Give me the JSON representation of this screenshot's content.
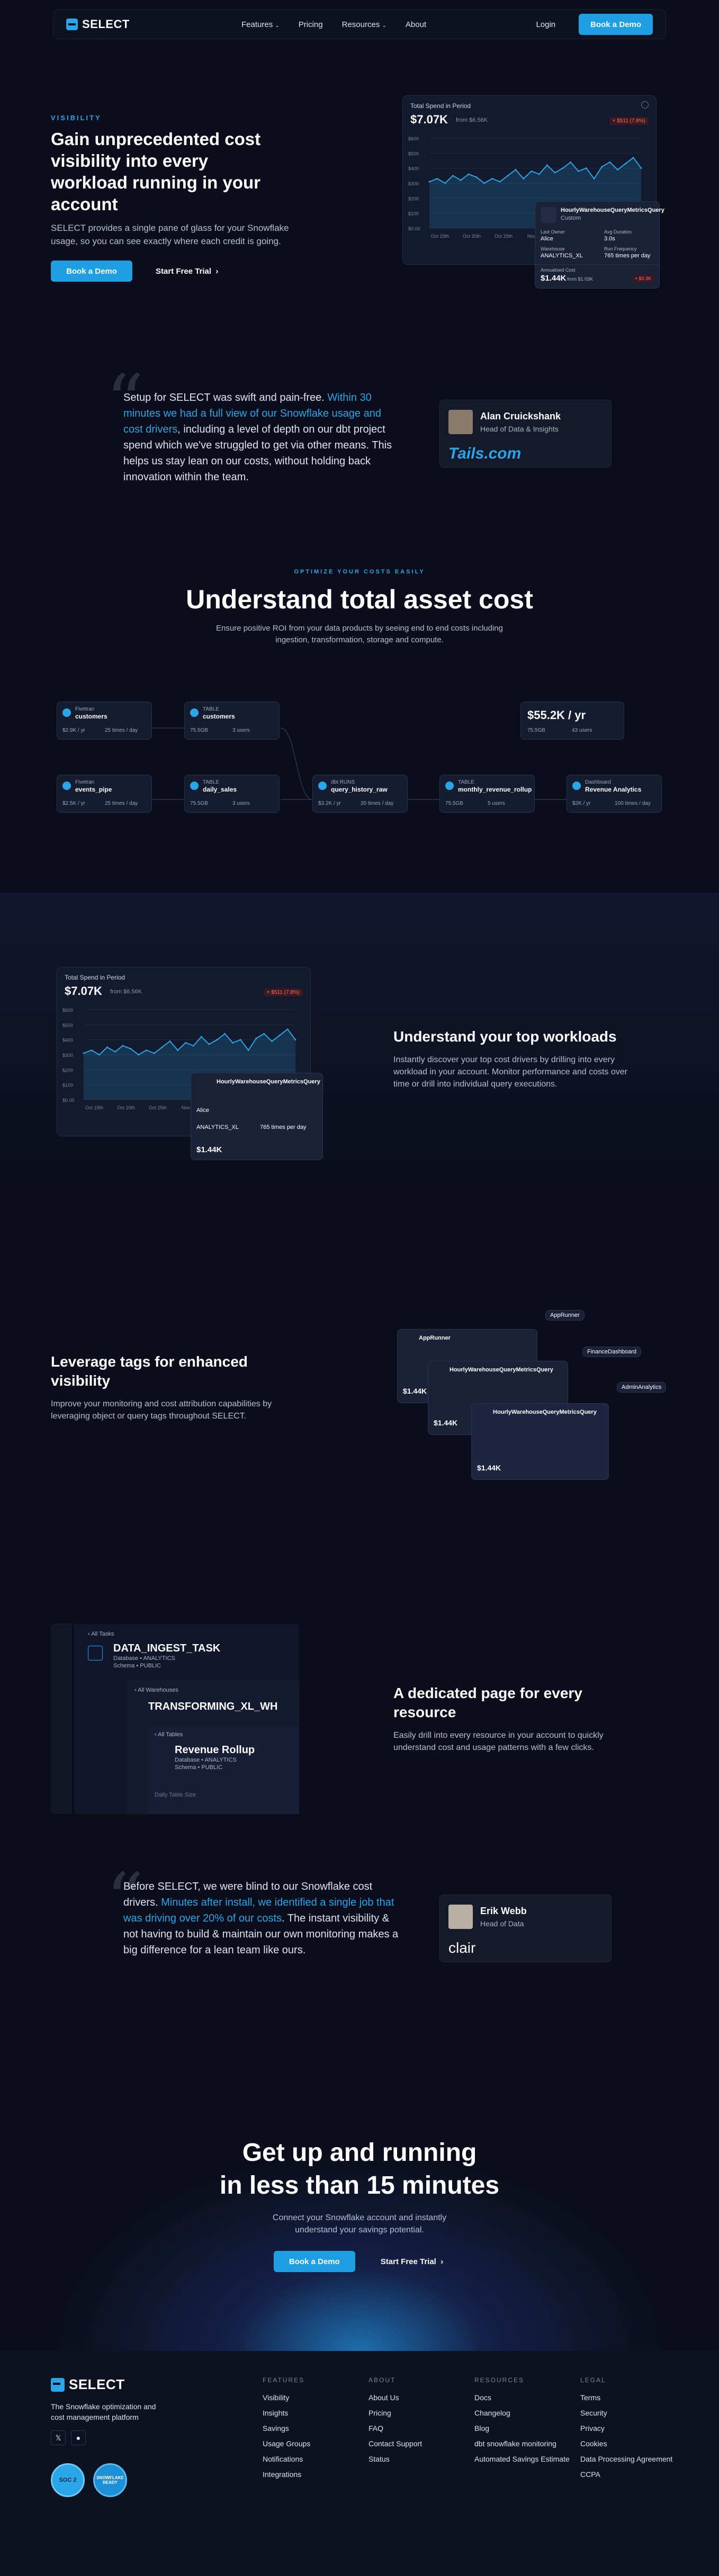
{
  "nav": {
    "brand": "SELECT",
    "links": [
      "Features",
      "Pricing",
      "Resources",
      "About"
    ],
    "login": "Login",
    "demo": "Book a Demo"
  },
  "hero": {
    "eyebrow": "VISIBILITY",
    "title": "Gain unprecedented cost visibility into every workload running in your account",
    "body": "SELECT provides a single pane of glass for your Snowflake usage, so you can see exactly where each credit is going.",
    "cta_primary": "Book a Demo",
    "cta_secondary": "Start Free Trial"
  },
  "spend_card": {
    "title": "Total Spend in Period",
    "value": "$7.07K",
    "from": "from $6.56K",
    "delta": "+ $511 (7.8%)",
    "yticks": [
      "$600",
      "$500",
      "$400",
      "$300",
      "$200",
      "$100",
      "$0.00"
    ],
    "xticks": [
      "Oct 15th",
      "Oct 20th",
      "Oct 25th",
      "Nov 1st",
      "Nov 5th",
      "Nov 10th",
      "Nov 15th"
    ],
    "chart_values": [
      310,
      330,
      300,
      350,
      320,
      360,
      340,
      300,
      330,
      310,
      350,
      390,
      330,
      380,
      360,
      420,
      370,
      400,
      440,
      380,
      400,
      330,
      410,
      440,
      390,
      430,
      470,
      400
    ]
  },
  "query_card": {
    "name": "HourlyWarehouseQueryMetricsQuery",
    "sub": "Custom",
    "user_label": "Last Owner",
    "user": "Alice",
    "freq_label": "Avg Duration",
    "freq": "3.0s",
    "wh_label": "Warehouse",
    "wh": "ANALYTICS_XL",
    "run_label": "Run Frequency",
    "run": "765 times per day",
    "cost_label": "Annualised Cost",
    "cost": "$1.44K",
    "cost_from": "from $1.03K",
    "cost_delta": "+ $0.3K"
  },
  "quote1": {
    "pre": "Setup for SELECT was swift and pain-free. ",
    "hl": "Within 30 minutes we had a full view of our Snowflake usage and cost drivers",
    "post": ", including a level of depth on our dbt project spend which we've struggled to get via other means. This helps us stay lean on our costs, without holding back innovation within the team.",
    "name": "Alan Cruickshank",
    "role": "Head of Data & Insights",
    "company": "Tails.com"
  },
  "tco": {
    "eyebrow": "OPTIMIZE YOUR COSTS EASILY",
    "title": "Understand total asset cost",
    "body": "Ensure positive ROI from your data products by seeing end to end costs including ingestion, transformation, storage and compute.",
    "total": "$55.2K / yr",
    "nodes": [
      {
        "kind": "Fivetran",
        "name": "customers",
        "a": "$2.9K / yr",
        "b": "25 times / day"
      },
      {
        "kind": "TABLE",
        "name": "customers",
        "a": "75.5GB",
        "b": "3 users"
      },
      {
        "kind": "Fivetran",
        "name": "events_pipe",
        "a": "$2.5K / yr",
        "b": "25 times / day"
      },
      {
        "kind": "TABLE",
        "name": "daily_sales",
        "a": "75.5GB",
        "b": "3 users"
      },
      {
        "kind": "dbt RUNS",
        "name": "query_history_raw",
        "a": "$3.2K / yr",
        "b": "20 times / day"
      },
      {
        "kind": "TABLE",
        "name": "monthly_revenue_rollup",
        "a": "75.5GB",
        "b": "5 users"
      },
      {
        "kind": "Dashboard",
        "name": "Revenue Analytics",
        "a": "$2K / yr",
        "b": "100 times / day"
      }
    ],
    "total_a": "75.5GB",
    "total_b": "43 users"
  },
  "workloads": {
    "title": "Understand your top workloads",
    "body": "Instantly discover your top cost drivers by drilling into every workload in your account. Monitor performance and costs over time or drill into individual query executions."
  },
  "tags": {
    "title": "Leverage tags for enhanced visibility",
    "body": "Improve your monitoring and cost attribution capabilities by leveraging object or query tags throughout SELECT.",
    "tag_labels": [
      "AppRunner",
      "FinanceDashboard",
      "AdminAnalytics"
    ],
    "cards": [
      "AppRunner",
      "HourlyWarehouseQueryMetricsQuery",
      "HourlyWarehouseQueryMetricsQuery"
    ],
    "cost": "$1.44K"
  },
  "resource": {
    "title": "A dedicated page for every resource",
    "body": "Easily drill into every resource in your account to quickly understand cost and usage patterns with a few clicks.",
    "l1_back": "All Tasks",
    "l1_title": "DATA_INGEST_TASK",
    "l1_sub1": "Database • ANALYTICS",
    "l1_sub2": "Schema • PUBLIC",
    "l2_back": "All Warehouses",
    "l2_title": "TRANSFORMING_XL_WH",
    "l3_back": "All Tables",
    "l3_title": "Revenue Rollup",
    "l3_sub1": "Database • ANALYTICS",
    "l3_sub2": "Schema • PUBLIC",
    "l3_foot": "Daily Table Size"
  },
  "quote2": {
    "pre": "Before SELECT, we were blind to our Snowflake cost drivers. ",
    "hl": "Minutes after install, we identified a single job that was driving over 20% of our costs",
    "post": ". The instant visibility & not having to build & maintain our own monitoring makes a big difference for a lean team like ours.",
    "name": "Erik Webb",
    "role": "Head of Data",
    "company": "clair"
  },
  "cta": {
    "title1": "Get up and running",
    "title2": "in less than 15 minutes",
    "body": "Connect your Snowflake account and instantly understand your savings potential.",
    "primary": "Book a Demo",
    "secondary": "Start Free Trial"
  },
  "footer": {
    "brand": "SELECT",
    "tagline": "The Snowflake optimization and cost management platform",
    "badge1": "SOC 2",
    "badge2": "SNOWFLAKE READY",
    "cols": [
      {
        "h": "FEATURES",
        "items": [
          "Visibility",
          "Insights",
          "Savings",
          "Usage Groups",
          "Notifications",
          "Integrations"
        ]
      },
      {
        "h": "ABOUT",
        "items": [
          "About Us",
          "Pricing",
          "FAQ",
          "Contact Support",
          "Status"
        ]
      },
      {
        "h": "RESOURCES",
        "items": [
          "Docs",
          "Changelog",
          "Blog",
          "dbt snowflake monitoring",
          "Automated Savings Estimate"
        ]
      },
      {
        "h": "LEGAL",
        "items": [
          "Terms",
          "Security",
          "Privacy",
          "Cookies",
          "Data Processing Agreement",
          "CCPA"
        ]
      }
    ]
  },
  "colors": {
    "accent": "#2aa5e8",
    "bg": "#0b0e1a",
    "danger": "#e0443e"
  }
}
